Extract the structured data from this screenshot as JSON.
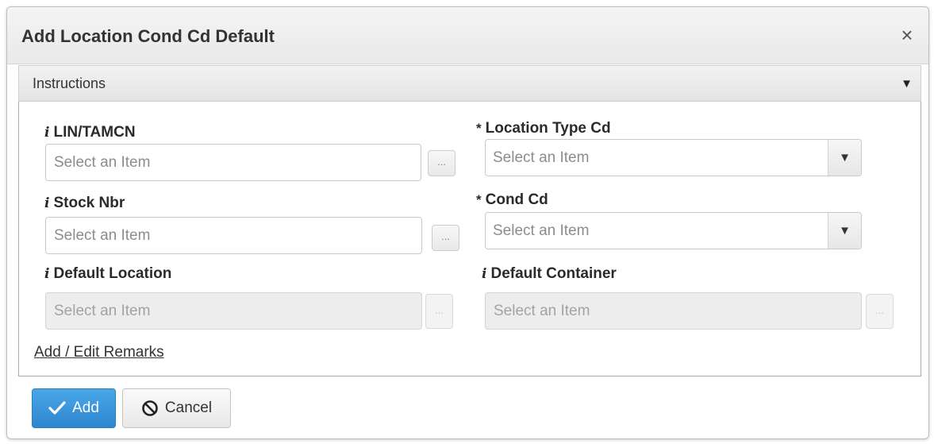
{
  "dialog": {
    "title": "Add Location Cond Cd Default",
    "close_symbol": "×",
    "close_icon": "close-icon"
  },
  "instructions": {
    "label": "Instructions",
    "caret_symbol": "▼",
    "expanded": false
  },
  "form": {
    "info_symbol": "i",
    "required_symbol": "*",
    "lin_tamcn": {
      "label": "LIN/TAMCN",
      "placeholder": "Select an Item",
      "value": ""
    },
    "location_type_cd": {
      "label": "Location Type Cd",
      "required": true,
      "selected": "Select an Item"
    },
    "stock_nbr": {
      "label": "Stock Nbr",
      "placeholder": "Select an Item",
      "value": ""
    },
    "cond_cd": {
      "label": "Cond Cd",
      "required": true,
      "selected": "Select an Item"
    },
    "default_location": {
      "label": "Default Location",
      "placeholder": "Select an Item",
      "disabled": true
    },
    "default_container": {
      "label": "Default Container",
      "placeholder": "Select an Item",
      "disabled": true
    },
    "lookup_button_label": "...",
    "select_caret_symbol": "▼"
  },
  "remarks_link": "Add / Edit Remarks",
  "actions": {
    "add_label": "Add",
    "cancel_label": "Cancel",
    "add_icon": "check-icon",
    "cancel_icon": "ban-icon",
    "add_color": "#3a93da"
  }
}
